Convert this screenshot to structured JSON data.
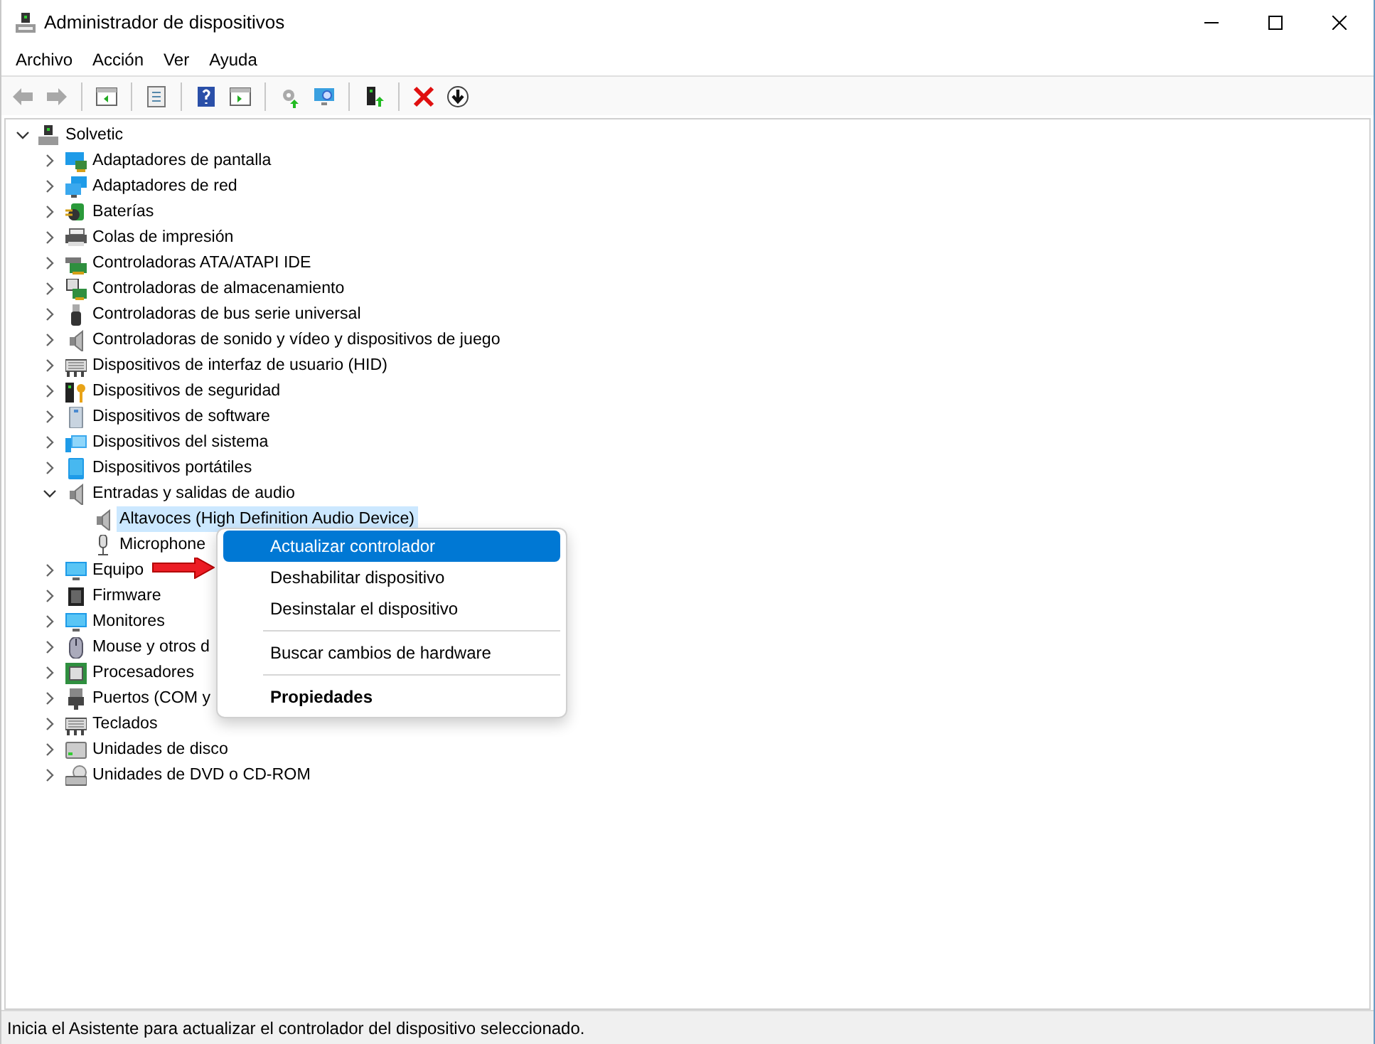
{
  "window": {
    "title": "Administrador de dispositivos"
  },
  "menu_bar": [
    "Archivo",
    "Acción",
    "Ver",
    "Ayuda"
  ],
  "toolbar": [
    {
      "disabled": true
    },
    {
      "disabled": true
    },
    {
      "disabled": false
    },
    {
      "disabled": false
    },
    {
      "disabled": false
    },
    {
      "disabled": false
    },
    {
      "disabled": false
    },
    {
      "disabled": false
    },
    {
      "disabled": false
    },
    {
      "disabled": false
    },
    {
      "disabled": false
    }
  ],
  "tree": [
    {
      "label": "Solvetic",
      "expanded": true,
      "selected": false,
      "children": [
        {
          "label": "Adaptadores de pantalla",
          "expanded": false,
          "selected": false
        },
        {
          "label": "Adaptadores de red",
          "expanded": false,
          "selected": false
        },
        {
          "label": "Baterías",
          "expanded": false,
          "selected": false
        },
        {
          "label": "Colas de impresión",
          "expanded": false,
          "selected": false
        },
        {
          "label": "Controladoras ATA/ATAPI IDE",
          "expanded": false,
          "selected": false
        },
        {
          "label": "Controladoras de almacenamiento",
          "expanded": false,
          "selected": false
        },
        {
          "label": "Controladoras de bus serie universal",
          "expanded": false,
          "selected": false
        },
        {
          "label": "Controladoras de sonido y vídeo y dispositivos de juego",
          "expanded": false,
          "selected": false
        },
        {
          "label": "Dispositivos de interfaz de usuario (HID)",
          "expanded": false,
          "selected": false
        },
        {
          "label": "Dispositivos de seguridad",
          "expanded": false,
          "selected": false
        },
        {
          "label": "Dispositivos de software",
          "expanded": false,
          "selected": false
        },
        {
          "label": "Dispositivos del sistema",
          "expanded": false,
          "selected": false
        },
        {
          "label": "Dispositivos portátiles",
          "expanded": false,
          "selected": false
        },
        {
          "label": "Entradas y salidas de audio",
          "expanded": true,
          "selected": false,
          "children": [
            {
              "label": "Altavoces (High Definition Audio Device)",
              "selected": true
            },
            {
              "label": "Microphone",
              "selected": false
            }
          ]
        },
        {
          "label": "Equipo",
          "expanded": false,
          "selected": false
        },
        {
          "label": "Firmware",
          "expanded": false,
          "selected": false
        },
        {
          "label": "Monitores",
          "expanded": false,
          "selected": false
        },
        {
          "label": "Mouse y otros d",
          "expanded": false,
          "selected": false
        },
        {
          "label": "Procesadores",
          "expanded": false,
          "selected": false
        },
        {
          "label": "Puertos (COM y",
          "expanded": false,
          "selected": false
        },
        {
          "label": "Teclados",
          "expanded": false,
          "selected": false
        },
        {
          "label": "Unidades de disco",
          "expanded": false,
          "selected": false
        },
        {
          "label": "Unidades de DVD o CD-ROM",
          "expanded": false,
          "selected": false
        }
      ]
    }
  ],
  "context_menu": [
    {
      "kind": "item",
      "label": "Actualizar controlador",
      "highlighted": true,
      "default": false
    },
    {
      "kind": "item",
      "label": "Deshabilitar dispositivo",
      "highlighted": false,
      "default": false
    },
    {
      "kind": "item",
      "label": "Desinstalar el dispositivo",
      "highlighted": false,
      "default": false
    },
    {
      "kind": "separator"
    },
    {
      "kind": "item",
      "label": "Buscar cambios de hardware",
      "highlighted": false,
      "default": false
    },
    {
      "kind": "separator"
    },
    {
      "kind": "item",
      "label": "Propiedades",
      "highlighted": false,
      "default": true
    }
  ],
  "status_bar": "Inicia el Asistente para actualizar el controlador del dispositivo seleccionado."
}
